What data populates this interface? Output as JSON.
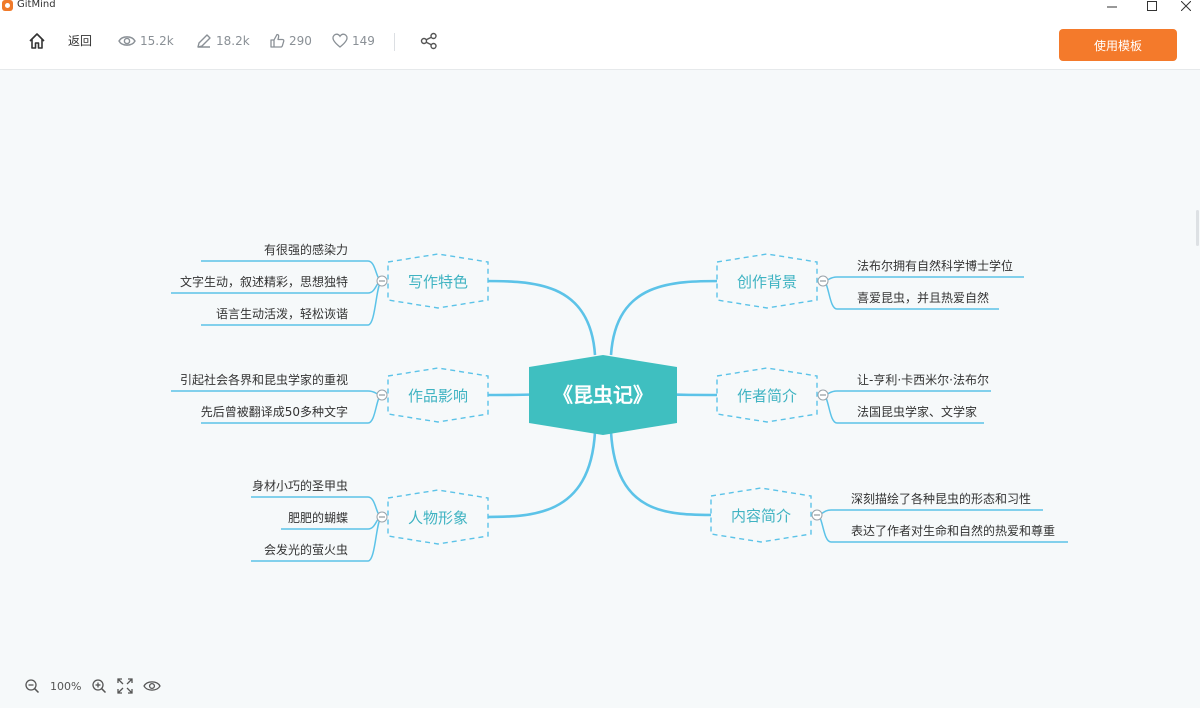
{
  "window": {
    "title": "GitMind"
  },
  "toolbar": {
    "back_label": "返回",
    "views": "15.2k",
    "edits": "18.2k",
    "likes": "290",
    "favorites": "149",
    "use_template_label": "使用模板"
  },
  "mindmap": {
    "root": "《昆虫记》",
    "branches": [
      {
        "label": "写作特色",
        "side": "left",
        "children": [
          "有很强的感染力",
          "文字生动，叙述精彩，思想独特",
          "语言生动活泼，轻松诙谐"
        ]
      },
      {
        "label": "作品影响",
        "side": "left",
        "children": [
          "引起社会各界和昆虫学家的重视",
          "先后曾被翻译成50多种文字"
        ]
      },
      {
        "label": "人物形象",
        "side": "left",
        "children": [
          "身材小巧的圣甲虫",
          "肥肥的蝴蝶",
          "会发光的萤火虫"
        ]
      },
      {
        "label": "创作背景",
        "side": "right",
        "children": [
          "法布尔拥有自然科学博士学位",
          "喜爱昆虫，并且热爱自然"
        ]
      },
      {
        "label": "作者简介",
        "side": "right",
        "children": [
          "让-亨利·卡西米尔·法布尔",
          "法国昆虫学家、文学家"
        ]
      },
      {
        "label": "内容简介",
        "side": "right",
        "children": [
          "深刻描绘了各种昆虫的形态和习性",
          "表达了作者对生命和自然的热爱和尊重"
        ]
      }
    ]
  },
  "zoom": {
    "level": "100%"
  },
  "colors": {
    "accent": "#f47a2b",
    "root_fill": "#3fbfc0",
    "branch_line": "#5cc3e8",
    "branch_text": "#3fb3c2"
  }
}
